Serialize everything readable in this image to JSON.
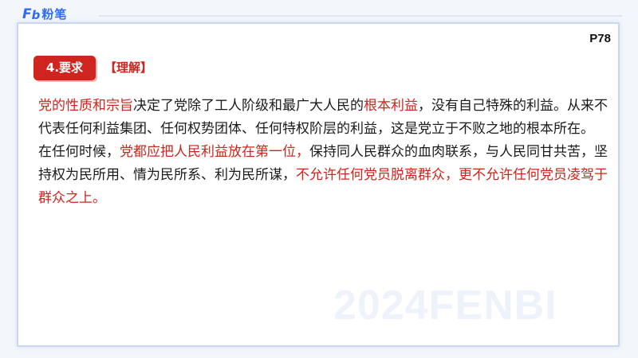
{
  "brand": {
    "logo_mark_f": "F",
    "logo_mark_b": "b",
    "name": "粉笔"
  },
  "page_number": "P78",
  "section": {
    "badge": "4.要求",
    "tag": "【理解】"
  },
  "paragraphs": [
    {
      "segments": [
        {
          "text": "党的性质和宗旨",
          "emphasis": true
        },
        {
          "text": "决定了党除了工人阶级和最广大人民的",
          "emphasis": false
        },
        {
          "text": "根本利益",
          "emphasis": true
        },
        {
          "text": "，没有自己特殊的利益。从来不代表任何利益集团、任何权势团体、任何特权阶层的利益，这是党立于不败之地的根本所在。",
          "emphasis": false
        }
      ]
    },
    {
      "segments": [
        {
          "text": "在任何时候，",
          "emphasis": false
        },
        {
          "text": "党都应把人民利益放在第一位，",
          "emphasis": true
        },
        {
          "text": "保持同人民群众的血肉联系，与人民同甘共苦，坚持权为民所用、情为民所系、利为民所谋，",
          "emphasis": false
        },
        {
          "text": "不允许任何党员脱离群众，更不允许任何党员凌驾于群众之上。",
          "emphasis": true
        }
      ]
    }
  ],
  "watermark": "2024FENBI",
  "colors": {
    "accent_red": "#d0241e",
    "brand_blue": "#2f6bf2",
    "frame_border": "#c9d6f2"
  }
}
